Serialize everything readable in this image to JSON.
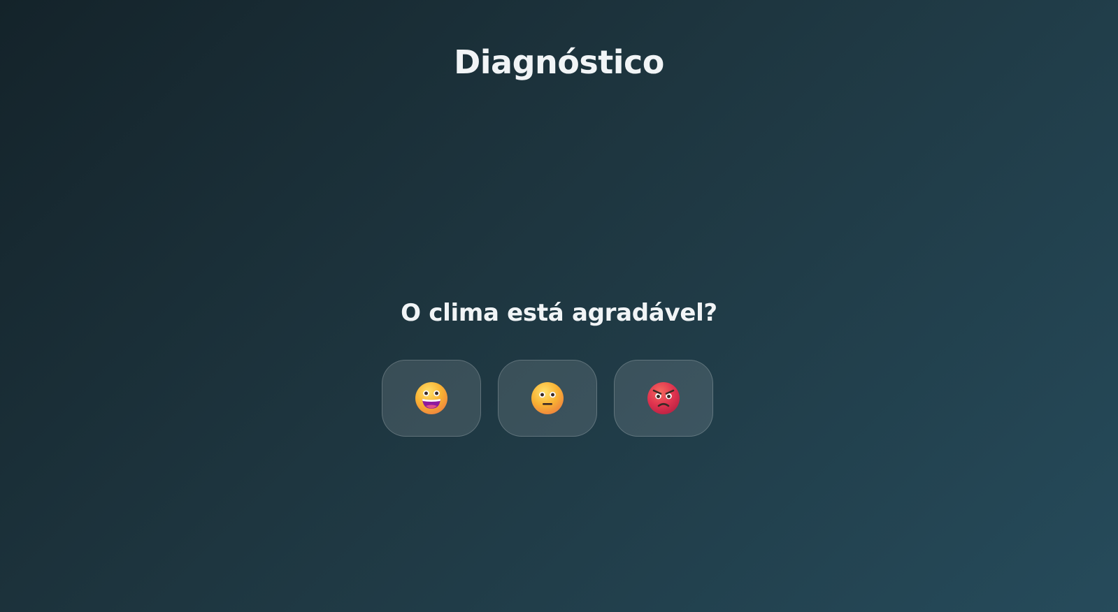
{
  "header": {
    "title": "Diagnóstico"
  },
  "question": {
    "text": "O clima está agradável?"
  },
  "options": [
    {
      "icon": "happy-face-icon",
      "color": "#f7b733"
    },
    {
      "icon": "neutral-face-icon",
      "color": "#f7b733"
    },
    {
      "icon": "angry-face-icon",
      "color": "#e0344f"
    }
  ],
  "colors": {
    "background_start": "#14232a",
    "background_end": "#264b5b",
    "text": "#f1f4f6"
  }
}
